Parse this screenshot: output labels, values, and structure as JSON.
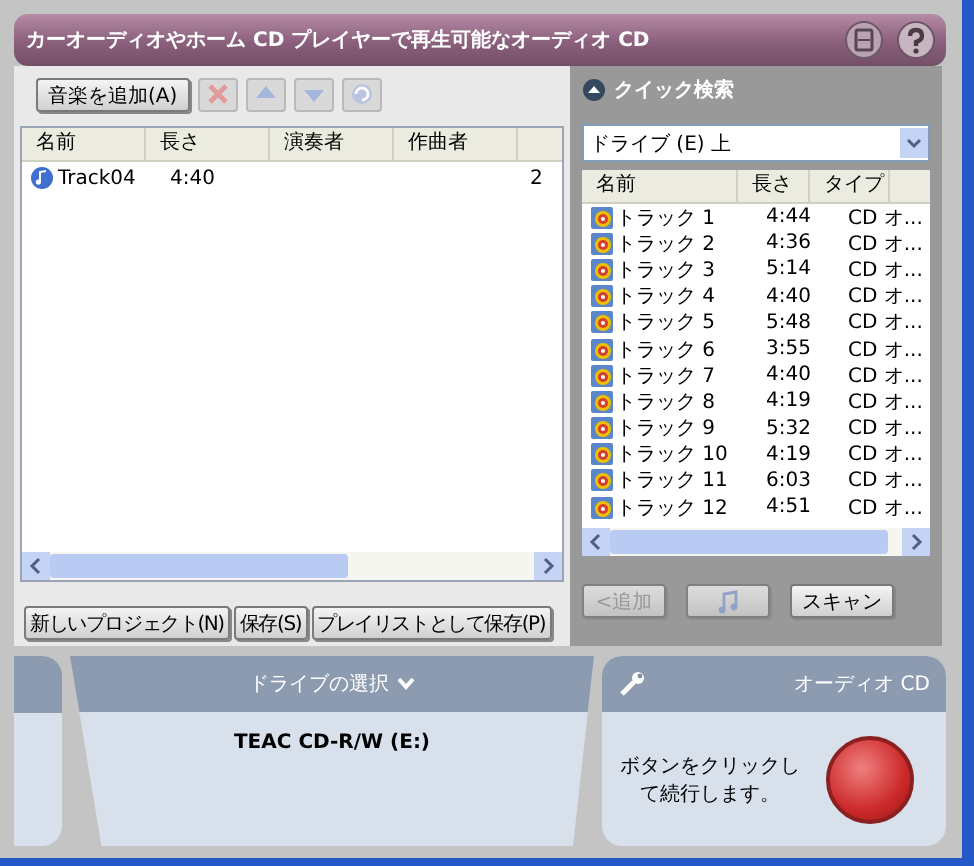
{
  "window": {
    "title": "カーオーディオやホーム CD プレイヤーで再生可能なオーディオ CD"
  },
  "toolbar": {
    "add_button": "音楽を追加(A)",
    "icon_buttons": [
      {
        "kind": "delete",
        "disabled": true
      },
      {
        "kind": "up",
        "disabled": true
      },
      {
        "kind": "down",
        "disabled": true
      },
      {
        "kind": "refresh",
        "disabled": true
      }
    ]
  },
  "project_list": {
    "columns": [
      "名前",
      "長さ",
      "演奏者",
      "作曲者"
    ],
    "rows": [
      {
        "name": "Track04",
        "length": "4:40",
        "performer": "",
        "composer": "",
        "column_5": "2"
      }
    ]
  },
  "project_buttons": [
    "新しいプロジェクト(N)",
    "保存(S)",
    "プレイリストとして保存(P)"
  ],
  "quick_search": {
    "title": "クイック検索",
    "expanded": true,
    "drive": "ドライブ (E) 上",
    "columns": [
      "名前",
      "長さ",
      "タイプ"
    ],
    "rows": [
      {
        "name": "トラック 1",
        "length": "4:44",
        "type": "CD オ..."
      },
      {
        "name": "トラック 2",
        "length": "4:36",
        "type": "CD オ..."
      },
      {
        "name": "トラック 3",
        "length": "5:14",
        "type": "CD オ..."
      },
      {
        "name": "トラック 4",
        "length": "4:40",
        "type": "CD オ..."
      },
      {
        "name": "トラック 5",
        "length": "5:48",
        "type": "CD オ..."
      },
      {
        "name": "トラック 6",
        "length": "3:55",
        "type": "CD オ..."
      },
      {
        "name": "トラック 7",
        "length": "4:40",
        "type": "CD オ..."
      },
      {
        "name": "トラック 8",
        "length": "4:19",
        "type": "CD オ..."
      },
      {
        "name": "トラック 9",
        "length": "5:32",
        "type": "CD オ..."
      },
      {
        "name": "トラック 10",
        "length": "4:19",
        "type": "CD オ..."
      },
      {
        "name": "トラック 11",
        "length": "6:03",
        "type": "CD オ..."
      },
      {
        "name": "トラック 12",
        "length": "4:51",
        "type": "CD オ..."
      }
    ],
    "buttons": [
      {
        "kind": "text",
        "label": "<追加",
        "disabled": true
      },
      {
        "kind": "note",
        "disabled": true
      },
      {
        "kind": "text",
        "label": "スキャン",
        "disabled": false
      }
    ]
  },
  "drive_select": {
    "title": "ドライブの選択",
    "drive": "TEAC CD-R/W (E:)"
  },
  "burn": {
    "title": "オーディオ CD",
    "hint": "ボタンをクリックして続行します。"
  }
}
